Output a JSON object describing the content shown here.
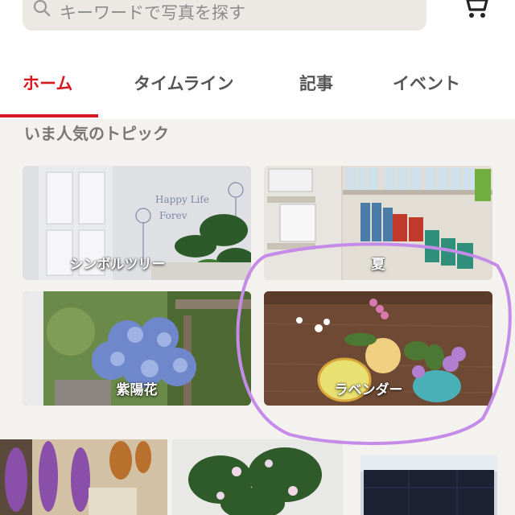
{
  "search": {
    "placeholder": "キーワードで写真を探す"
  },
  "icons": {
    "search": "search-icon",
    "cart": "cart-icon"
  },
  "tabs": [
    {
      "label": "ホーム",
      "active": true
    },
    {
      "label": "タイムライン",
      "active": false
    },
    {
      "label": "記事",
      "active": false
    },
    {
      "label": "イベント",
      "active": false
    }
  ],
  "section": {
    "title": "いま人気のトピック"
  },
  "topics": [
    {
      "label": "シンボルツリー"
    },
    {
      "label": "夏"
    },
    {
      "label": "紫陽花"
    },
    {
      "label": "ラベンダー"
    }
  ],
  "colors": {
    "accent": "#d7191f",
    "annotation": "#c58be8"
  }
}
